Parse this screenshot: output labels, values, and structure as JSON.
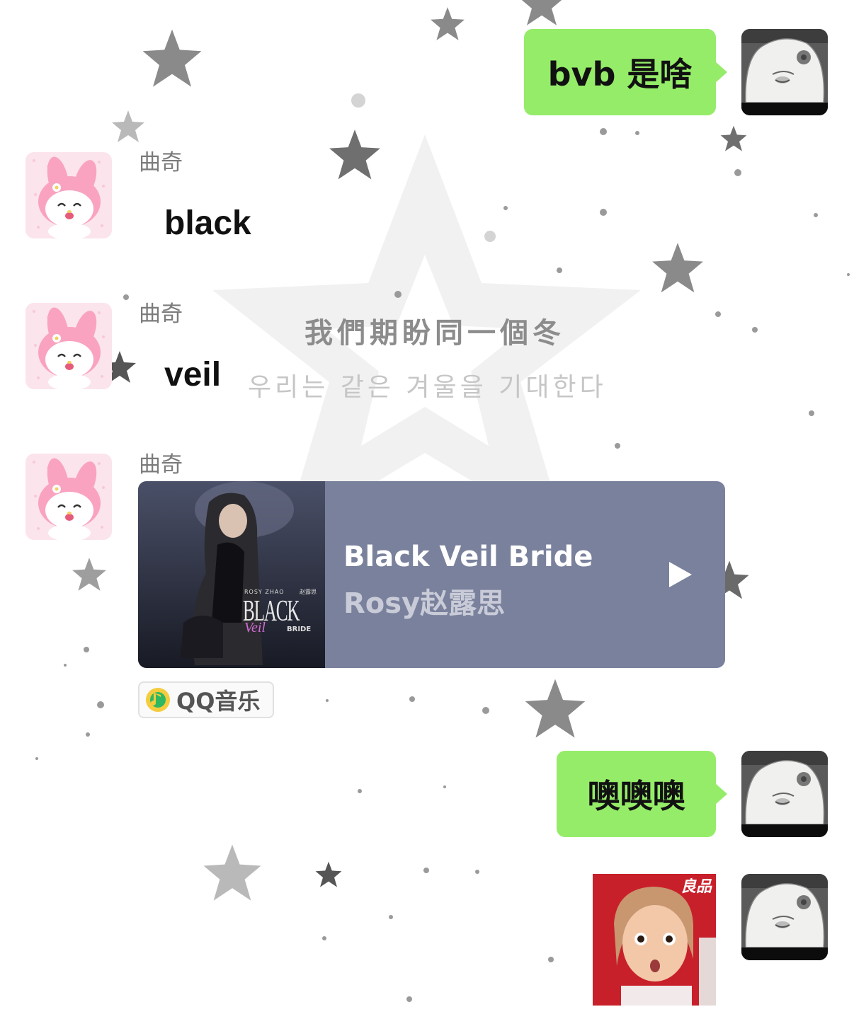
{
  "background": {
    "watermark_line_1": "我們期盼同一個冬",
    "watermark_line_2": "우리는 같은 겨울을 기대한다",
    "star_color": "#8a8a8a"
  },
  "colors": {
    "outgoing_bubble": "#95ec69",
    "music_card": "#7a819c"
  },
  "messages": [
    {
      "id": "m1",
      "direction": "outgoing",
      "type": "text",
      "text": "bvb 是啥",
      "avatar": "cartoon-face-avatar"
    },
    {
      "id": "m2",
      "direction": "incoming",
      "type": "text",
      "sender": "曲奇",
      "text": "black",
      "avatar": "melody-bunny-avatar"
    },
    {
      "id": "m3",
      "direction": "incoming",
      "type": "text",
      "sender": "曲奇",
      "text": "veil",
      "avatar": "melody-bunny-avatar"
    },
    {
      "id": "m4",
      "direction": "incoming",
      "type": "music",
      "sender": "曲奇",
      "avatar": "melody-bunny-avatar",
      "music": {
        "title": "Black Veil Bride",
        "artist": "Rosy赵露思",
        "cover_text_artist": "ROSY ZHAO",
        "cover_text_artist_cn": "赵露思",
        "cover_text_main": "BLACK",
        "cover_text_script": "Veil",
        "cover_text_sub": "BRIDE",
        "source": "QQ音乐"
      }
    },
    {
      "id": "m5",
      "direction": "outgoing",
      "type": "text",
      "text": "噢噢噢",
      "avatar": "cartoon-face-avatar"
    },
    {
      "id": "m6",
      "direction": "outgoing",
      "type": "sticker",
      "sticker": "surprised-woman-sticker",
      "sticker_text": "良品",
      "avatar": "cartoon-face-avatar"
    }
  ]
}
